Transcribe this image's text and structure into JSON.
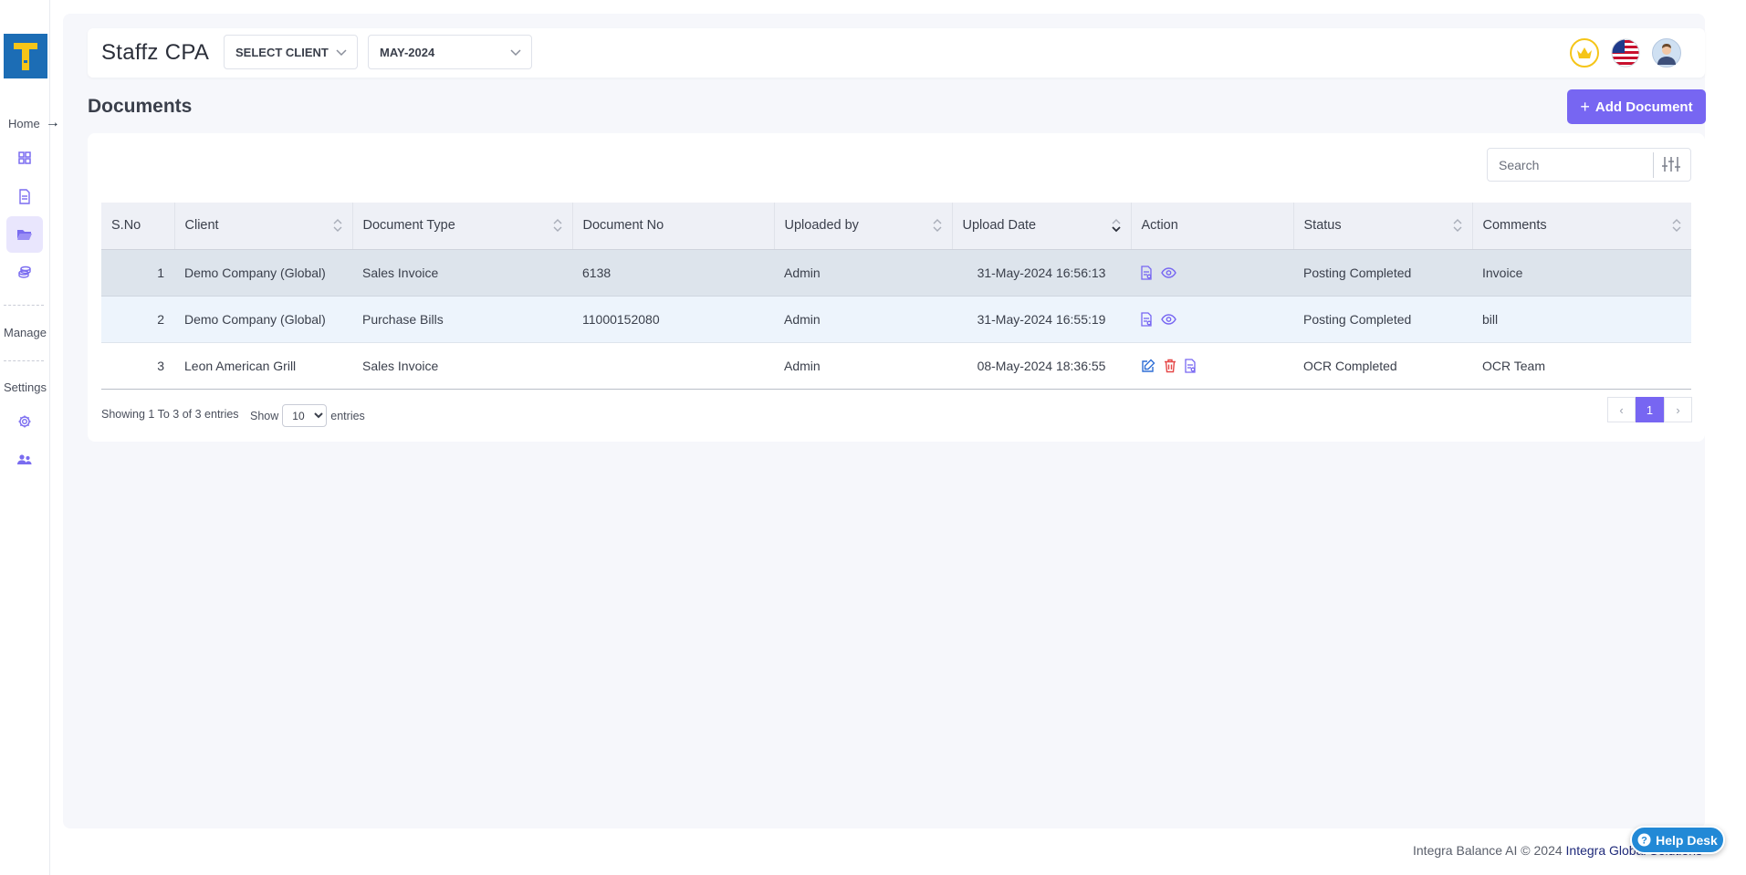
{
  "app": {
    "brand": "Staffz CPA"
  },
  "sidebar": {
    "home_label": "Home",
    "manage_label": "Manage",
    "settings_label": "Settings",
    "icons": [
      "dashboard-icon",
      "document-icon",
      "folder-open-icon",
      "coins-icon",
      "gear-icon",
      "users-icon"
    ]
  },
  "topbar": {
    "client_select": "SELECT CLIENT",
    "period_select": "MAY-2024"
  },
  "page": {
    "title": "Documents",
    "add_button": "Add Document",
    "search_placeholder": "Search"
  },
  "table": {
    "columns": [
      "S.No",
      "Client",
      "Document Type",
      "Document No",
      "Uploaded by",
      "Upload Date",
      "Action",
      "Status",
      "Comments"
    ],
    "rows": [
      {
        "sno": "1",
        "client": "Demo Company (Global)",
        "doc_type": "Sales Invoice",
        "doc_no": "6138",
        "uploaded_by": "Admin",
        "upload_date": "31-May-2024 16:56:13",
        "actions": [
          "view-document-icon",
          "eye-icon"
        ],
        "status": "Posting Completed",
        "comments": "Invoice"
      },
      {
        "sno": "2",
        "client": "Demo Company (Global)",
        "doc_type": "Purchase Bills",
        "doc_no": "11000152080",
        "uploaded_by": "Admin",
        "upload_date": "31-May-2024 16:55:19",
        "actions": [
          "view-document-icon",
          "eye-icon"
        ],
        "status": "Posting Completed",
        "comments": "bill"
      },
      {
        "sno": "3",
        "client": "Leon American Grill",
        "doc_type": "Sales Invoice",
        "doc_no": "",
        "uploaded_by": "Admin",
        "upload_date": "08-May-2024 18:36:55",
        "actions": [
          "edit-icon",
          "trash-icon",
          "view-document-icon"
        ],
        "status": "OCR Completed",
        "comments": "OCR Team"
      }
    ]
  },
  "pagination": {
    "info": "Showing 1 To 3 of 3 entries",
    "show_label": "Show",
    "page_size": "10",
    "entries_label": "entries",
    "current_page": "1"
  },
  "footer": {
    "copyright": "Integra Balance AI © 2024",
    "company_link": "Integra Global Solutions",
    "help_desk": "Help Desk"
  },
  "colors": {
    "accent": "#7766f2",
    "logo_bg": "#1c6db5",
    "logo_fg": "#f5c518",
    "danger": "#e54848",
    "help": "#2289d6"
  }
}
